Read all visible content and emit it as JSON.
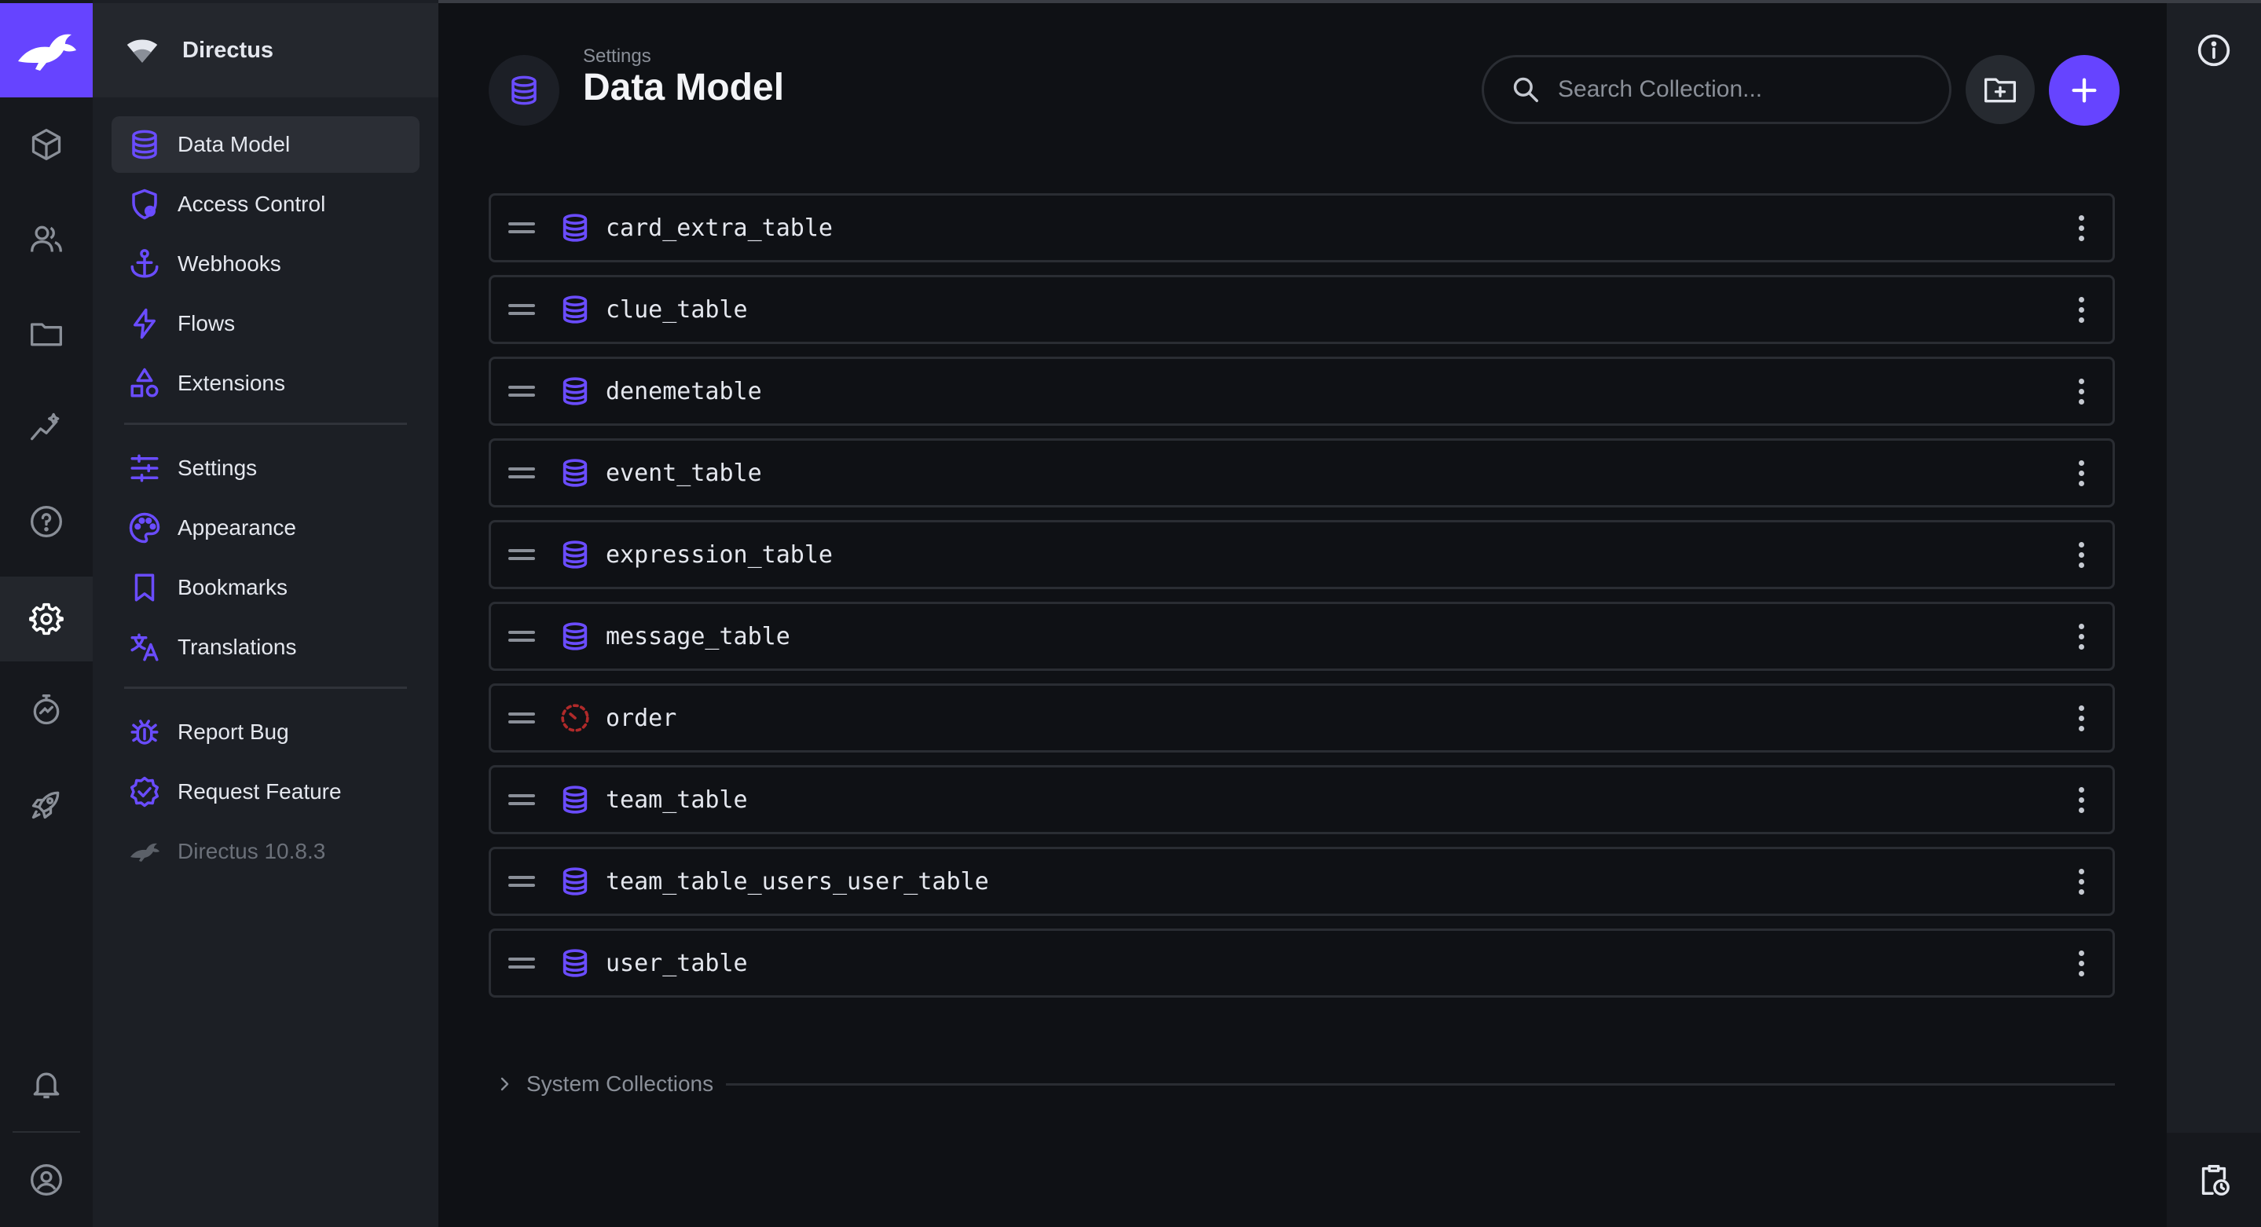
{
  "app": {
    "project_name": "Directus",
    "version": "Directus 10.8.3"
  },
  "module_bar": {
    "items": [
      {
        "name": "content",
        "icon": "box-icon"
      },
      {
        "name": "users",
        "icon": "users-icon"
      },
      {
        "name": "files",
        "icon": "folder-icon"
      },
      {
        "name": "insights",
        "icon": "insights-icon"
      },
      {
        "name": "help",
        "icon": "help-icon"
      },
      {
        "name": "settings",
        "icon": "gear-icon",
        "active": true
      },
      {
        "name": "monitor",
        "icon": "timer-icon"
      },
      {
        "name": "marketplace",
        "icon": "rocket-icon"
      }
    ],
    "bottom": [
      {
        "name": "notifications",
        "icon": "bell-icon"
      },
      {
        "name": "account",
        "icon": "user-circle-icon"
      }
    ]
  },
  "nav": {
    "group1": [
      {
        "label": "Data Model",
        "icon": "database-icon",
        "active": true
      },
      {
        "label": "Access Control",
        "icon": "shield-icon"
      },
      {
        "label": "Webhooks",
        "icon": "anchor-icon"
      },
      {
        "label": "Flows",
        "icon": "bolt-icon"
      },
      {
        "label": "Extensions",
        "icon": "shapes-icon"
      }
    ],
    "group2": [
      {
        "label": "Settings",
        "icon": "sliders-icon"
      },
      {
        "label": "Appearance",
        "icon": "palette-icon"
      },
      {
        "label": "Bookmarks",
        "icon": "bookmark-icon"
      },
      {
        "label": "Translations",
        "icon": "translate-icon"
      }
    ],
    "group3": [
      {
        "label": "Report Bug",
        "icon": "bug-icon"
      },
      {
        "label": "Request Feature",
        "icon": "verified-icon"
      }
    ]
  },
  "header": {
    "breadcrumb": "Settings",
    "title": "Data Model",
    "search_placeholder": "Search Collection..."
  },
  "collections": [
    {
      "name": "card_extra_table",
      "icon": "database-icon"
    },
    {
      "name": "clue_table",
      "icon": "database-icon"
    },
    {
      "name": "denemetable",
      "icon": "database-icon"
    },
    {
      "name": "event_table",
      "icon": "database-icon"
    },
    {
      "name": "expression_table",
      "icon": "database-icon"
    },
    {
      "name": "message_table",
      "icon": "database-icon"
    },
    {
      "name": "order",
      "icon": "dotted-clock-icon"
    },
    {
      "name": "team_table",
      "icon": "database-icon"
    },
    {
      "name": "team_table_users_user_table",
      "icon": "database-icon"
    },
    {
      "name": "user_table",
      "icon": "database-icon"
    }
  ],
  "system_collections_label": "System Collections",
  "colors": {
    "accent": "#6644ff",
    "icon_purple": "#6a4cff",
    "warning_red": "#b02a2a",
    "background": "#0f1115",
    "sidebar": "#1c1f25"
  }
}
